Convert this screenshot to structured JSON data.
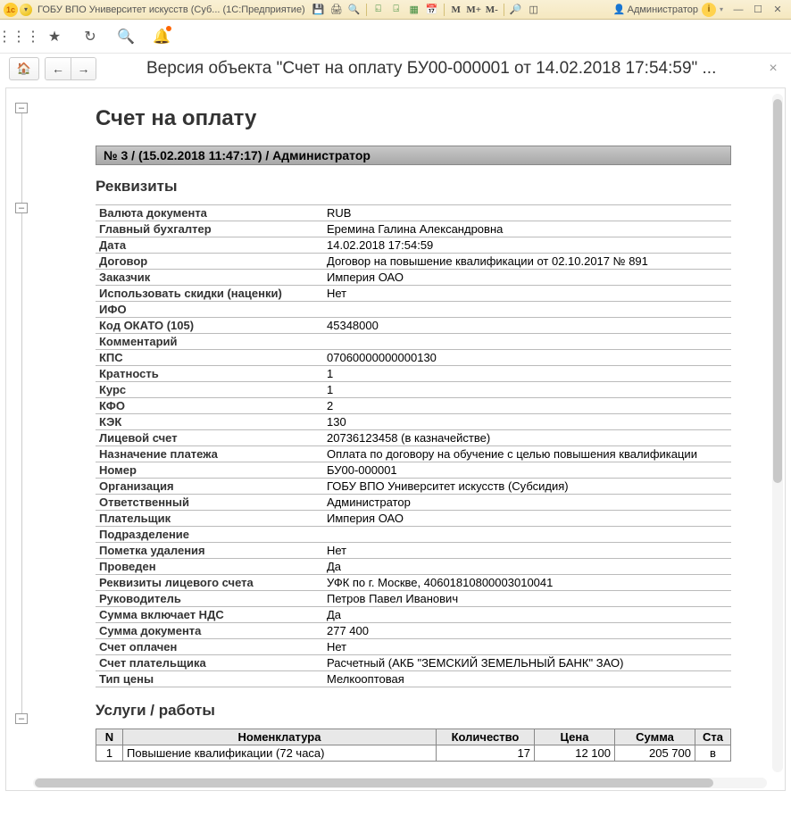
{
  "titlebar": {
    "app_logo": "1c",
    "title": "ГОБУ ВПО Университет искусств (Суб...  (1С:Предприятие)",
    "user": "Администратор",
    "m_labels": [
      "M",
      "M+",
      "M-"
    ]
  },
  "page": {
    "title": "Версия объекта \"Счет на оплату БУ00-000001 от 14.02.2018 17:54:59\" ..."
  },
  "document": {
    "h1": "Счет на оплату",
    "version_bar": "№ 3 / (15.02.2018 11:47:17) / Администратор",
    "h2_requisites": "Реквизиты",
    "h2_services": "Услуги / работы",
    "requisites": [
      {
        "k": "Валюта документа",
        "v": "RUB"
      },
      {
        "k": "Главный бухгалтер",
        "v": "Еремина Галина Александровна"
      },
      {
        "k": "Дата",
        "v": "14.02.2018 17:54:59"
      },
      {
        "k": "Договор",
        "v": "Договор на повышение квалификации от 02.10.2017 № 891"
      },
      {
        "k": "Заказчик",
        "v": "Империя ОАО"
      },
      {
        "k": "Использовать скидки (наценки)",
        "v": "Нет"
      },
      {
        "k": "ИФО",
        "v": ""
      },
      {
        "k": "Код ОКАТО (105)",
        "v": "45348000"
      },
      {
        "k": "Комментарий",
        "v": ""
      },
      {
        "k": "КПС",
        "v": "07060000000000130"
      },
      {
        "k": "Кратность",
        "v": "1"
      },
      {
        "k": "Курс",
        "v": "1"
      },
      {
        "k": "КФО",
        "v": "2"
      },
      {
        "k": "КЭК",
        "v": "130"
      },
      {
        "k": "Лицевой счет",
        "v": "20736123458 (в казначействе)"
      },
      {
        "k": "Назначение платежа",
        "v": "Оплата по договору на обучение с целью повышения квалификации"
      },
      {
        "k": "Номер",
        "v": "БУ00-000001"
      },
      {
        "k": "Организация",
        "v": "ГОБУ ВПО Университет искусств (Субсидия)"
      },
      {
        "k": "Ответственный",
        "v": "Администратор"
      },
      {
        "k": "Плательщик",
        "v": "Империя ОАО"
      },
      {
        "k": "Подразделение",
        "v": ""
      },
      {
        "k": "Пометка удаления",
        "v": "Нет"
      },
      {
        "k": "Проведен",
        "v": "Да"
      },
      {
        "k": "Реквизиты лицевого счета",
        "v": "УФК по г. Москве, 40601810800003010041"
      },
      {
        "k": "Руководитель",
        "v": "Петров Павел Иванович"
      },
      {
        "k": "Сумма включает НДС",
        "v": "Да"
      },
      {
        "k": "Сумма документа",
        "v": "277 400"
      },
      {
        "k": "Счет оплачен",
        "v": "Нет"
      },
      {
        "k": "Счет плательщика",
        "v": "Расчетный (АКБ \"ЗЕМСКИЙ ЗЕМЕЛЬНЫЙ БАНК\" ЗАО)"
      },
      {
        "k": "Тип цены",
        "v": "Мелкооптовая"
      }
    ],
    "services": {
      "headers": [
        "N",
        "Номенклатура",
        "Количество",
        "Цена",
        "Сумма",
        "Ста"
      ],
      "rows": [
        {
          "n": "1",
          "name": "Повышение квалификации (72 часа)",
          "qty": "17",
          "price": "12 100",
          "sum": "205 700",
          "rate": "в"
        }
      ]
    }
  }
}
